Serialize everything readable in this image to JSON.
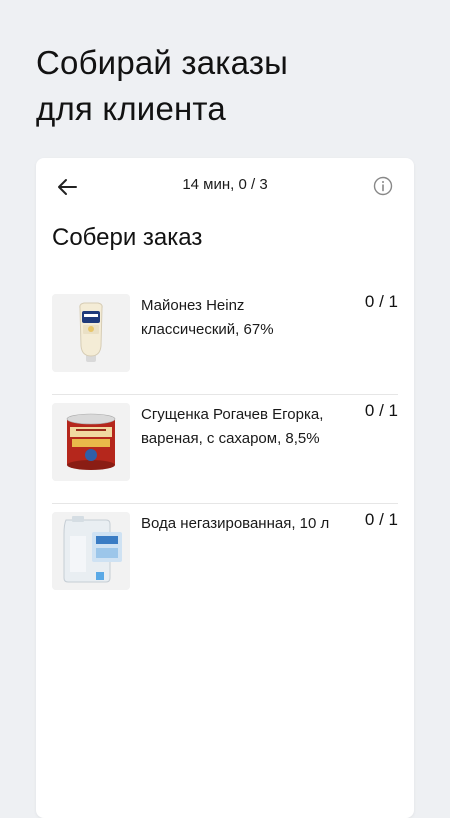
{
  "headline": {
    "line1": "Собирай заказы",
    "line2": "для клиента"
  },
  "topbar": {
    "title": "14 мин, 0 / 3",
    "back_icon": "arrow-left-icon",
    "info_icon": "info-icon"
  },
  "section_title": "Собери заказ",
  "items": [
    {
      "name": "Майонез Heinz классический, 67%",
      "qty": "0 / 1",
      "image": "mayonnaise-bottle"
    },
    {
      "name": "Сгущенка Рогачев Егорка, вареная, с сахаром, 8,5%",
      "qty": "0 / 1",
      "image": "condensed-milk-can"
    },
    {
      "name": "Вода негазированная, 10 л",
      "qty": "0 / 1",
      "image": "water-canister"
    }
  ]
}
